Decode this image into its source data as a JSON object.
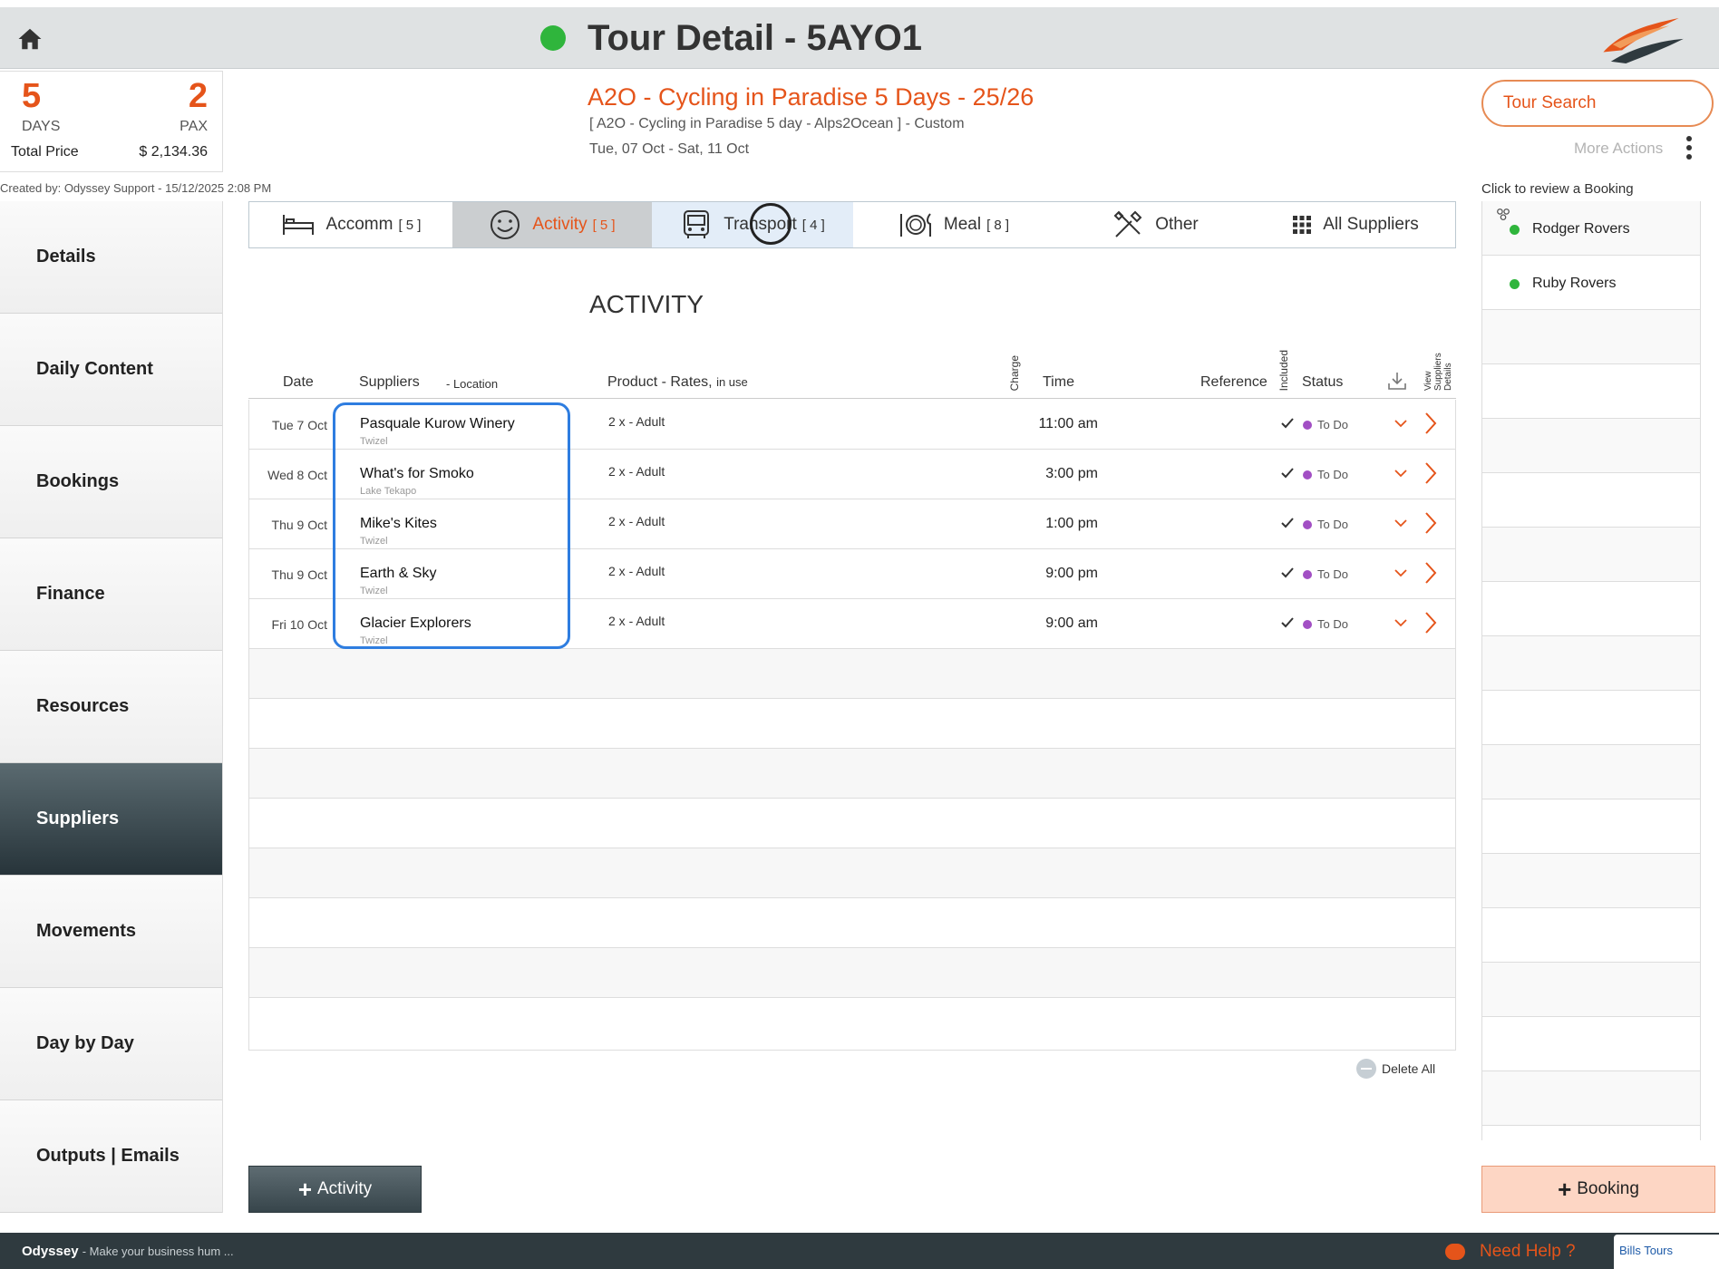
{
  "header": {
    "title": "Tour Detail - 5AYO1"
  },
  "summary": {
    "days": "5",
    "days_label": "DAYS",
    "pax": "2",
    "pax_label": "PAX",
    "total_price_label": "Total Price",
    "total_price": "$ 2,134.36"
  },
  "created_by": "Created by: Odyssey Support - 15/12/2025 2:08 PM",
  "tour": {
    "name": "A2O - Cycling in Paradise 5 Days - 25/26",
    "subtitle": "[ A2O - Cycling in Paradise 5 day - Alps2Ocean ] - Custom",
    "dates": "Tue, 07 Oct  - Sat, 11 Oct"
  },
  "actions": {
    "tour_search": "Tour Search",
    "more_actions": "More Actions",
    "review_label": "Click to review a Booking"
  },
  "sidebar": {
    "items": [
      {
        "label": "Details"
      },
      {
        "label": "Daily Content"
      },
      {
        "label": "Bookings"
      },
      {
        "label": "Finance"
      },
      {
        "label": "Resources"
      },
      {
        "label": "Suppliers"
      },
      {
        "label": "Movements"
      },
      {
        "label": "Day by Day"
      },
      {
        "label": "Outputs | Emails"
      }
    ]
  },
  "tabs": [
    {
      "label": "Accomm",
      "count": "[ 5 ]",
      "icon": "bed-icon"
    },
    {
      "label": "Activity",
      "count": "[ 5 ]",
      "icon": "smiley-icon"
    },
    {
      "label": "Transport",
      "count": "[ 4 ]",
      "icon": "bus-icon"
    },
    {
      "label": "Meal",
      "count": "[ 8 ]",
      "icon": "plate-icon"
    },
    {
      "label": "Other",
      "count": "",
      "icon": "tools-icon"
    },
    {
      "label": "All Suppliers",
      "count": "",
      "icon": "grid-icon"
    }
  ],
  "section_title": "ACTIVITY",
  "table": {
    "headers": {
      "date": "Date",
      "suppliers": "Suppliers",
      "location": "- Location",
      "product": "Product - Rates,",
      "product_suffix": "in use",
      "charge": "Charge",
      "time": "Time",
      "reference": "Reference",
      "included": "Included",
      "status": "Status",
      "view_details": "View Suppliers Details"
    },
    "rows": [
      {
        "date": "Tue 7 Oct",
        "supplier": "Pasquale Kurow Winery",
        "location": "Twizel",
        "product": "2 x  - Adult",
        "time": "11:00 am",
        "status": "To Do"
      },
      {
        "date": "Wed 8 Oct",
        "supplier": "What's for Smoko",
        "location": "Lake Tekapo",
        "product": "2 x  - Adult",
        "time": "3:00 pm",
        "status": "To Do"
      },
      {
        "date": "Thu 9 Oct",
        "supplier": "Mike's Kites",
        "location": "Twizel",
        "product": "2 x  - Adult",
        "time": "1:00 pm",
        "status": "To Do"
      },
      {
        "date": "Thu 9 Oct",
        "supplier": "Earth & Sky",
        "location": "Twizel",
        "product": "2 x  - Adult",
        "time": "9:00 pm",
        "status": "To Do"
      },
      {
        "date": "Fri 10 Oct",
        "supplier": "Glacier Explorers",
        "location": "Twizel",
        "product": "2 x  - Adult",
        "time": "9:00 am",
        "status": "To Do"
      }
    ]
  },
  "delete_all": "Delete All",
  "add_activity": "Activity",
  "bookings": [
    {
      "name": "Rodger Rovers"
    },
    {
      "name": "Ruby Rovers"
    }
  ],
  "add_booking": "Booking",
  "footer": {
    "brand": "Odyssey",
    "tagline": "- Make your business hum ...",
    "help": "Need Help ?",
    "partner": "Bills Tours"
  },
  "colors": {
    "accent": "#e5541a",
    "status_green": "#2fb53c",
    "status_purple": "#a24fc4",
    "highlight": "#2e7de0"
  }
}
